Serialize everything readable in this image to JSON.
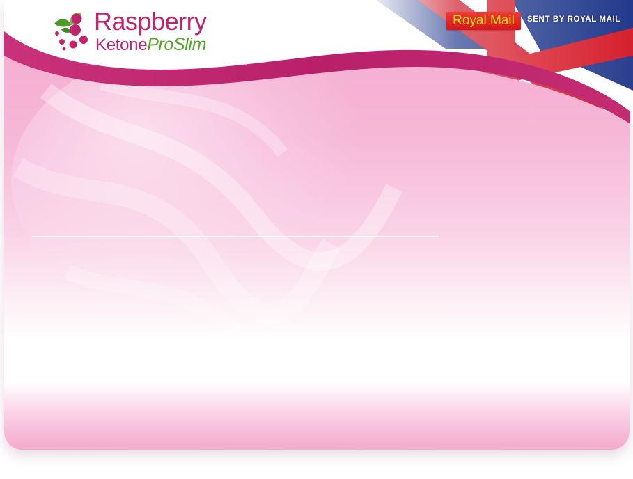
{
  "brand": {
    "name_line1": "Raspberry",
    "name_line2_part1": "Ketone",
    "name_line2_part2": "ProSlim",
    "icon": "raspberry-leaf-logo-icon"
  },
  "shipping": {
    "badge_label": "Royal Mail",
    "sent_label": "SENT BY ROYAL MAIL",
    "flag_icon": "union-jack-flag-icon"
  },
  "colors": {
    "brand_pink": "#c4226d",
    "brand_green": "#55a52a",
    "header_band": "#c0266c",
    "background_pink": "#f4a9cf",
    "royal_mail_red": "#d8151c",
    "royal_mail_yellow": "#ffe11a"
  }
}
